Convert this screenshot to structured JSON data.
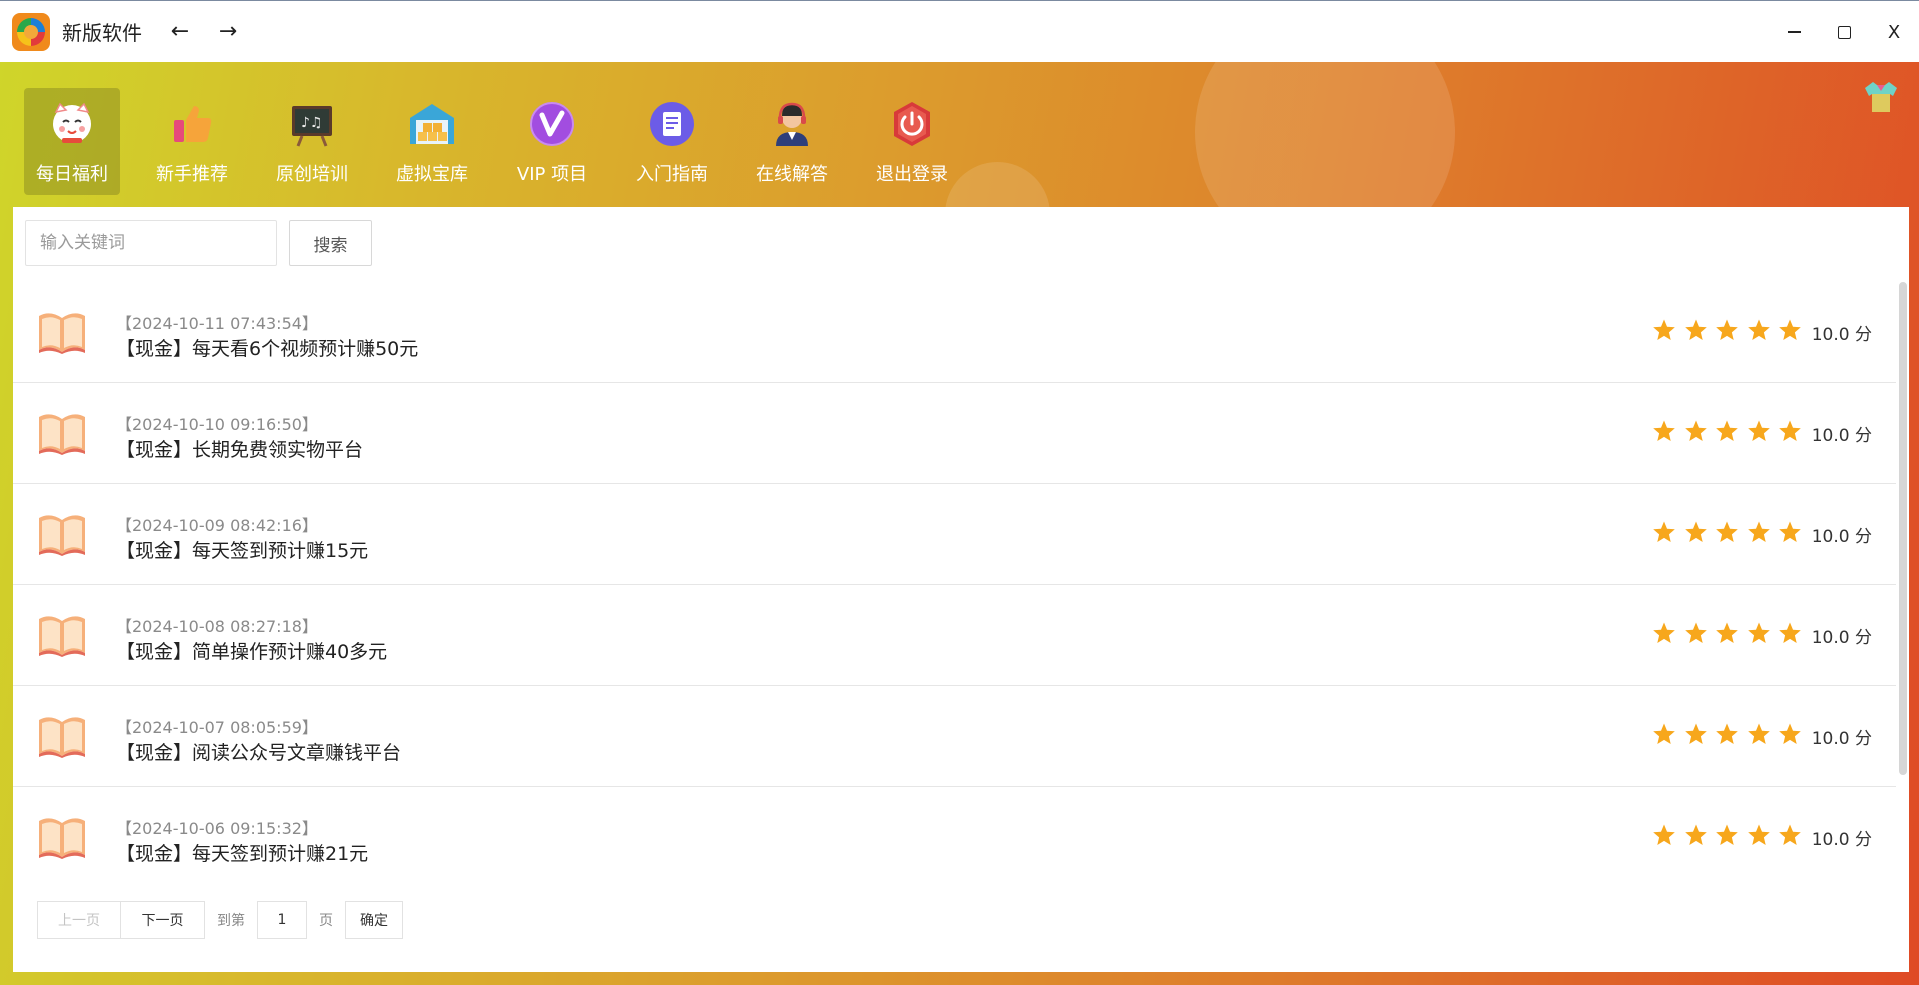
{
  "window": {
    "title": "新版软件",
    "back_icon": "←",
    "forward_icon": "→",
    "close_icon": "X"
  },
  "toolbar": {
    "items": [
      {
        "label": "每日福利",
        "icon": "lucky-cat-icon",
        "active": true
      },
      {
        "label": "新手推荐",
        "icon": "thumbs-up-icon",
        "active": false
      },
      {
        "label": "原创培训",
        "icon": "blackboard-icon",
        "active": false
      },
      {
        "label": "虚拟宝库",
        "icon": "warehouse-icon",
        "active": false
      },
      {
        "label": "VIP 项目",
        "icon": "vip-badge-icon",
        "active": false
      },
      {
        "label": "入门指南",
        "icon": "document-icon",
        "active": false
      },
      {
        "label": "在线解答",
        "icon": "support-agent-icon",
        "active": false
      },
      {
        "label": "退出登录",
        "icon": "power-icon",
        "active": false
      }
    ]
  },
  "search": {
    "placeholder": "输入关键词",
    "value": "",
    "button_label": "搜索"
  },
  "list": {
    "items": [
      {
        "date": "【2024-10-11 07:43:54】",
        "title": "【现金】每天看6个视频预计赚50元",
        "stars": 5,
        "score": "10.0 分"
      },
      {
        "date": "【2024-10-10 09:16:50】",
        "title": "【现金】长期免费领实物平台",
        "stars": 5,
        "score": "10.0 分"
      },
      {
        "date": "【2024-10-09 08:42:16】",
        "title": "【现金】每天签到预计赚15元",
        "stars": 5,
        "score": "10.0 分"
      },
      {
        "date": "【2024-10-08 08:27:18】",
        "title": "【现金】简单操作预计赚40多元",
        "stars": 5,
        "score": "10.0 分"
      },
      {
        "date": "【2024-10-07 08:05:59】",
        "title": "【现金】阅读公众号文章赚钱平台",
        "stars": 5,
        "score": "10.0 分"
      },
      {
        "date": "【2024-10-06 09:15:32】",
        "title": "【现金】每天签到预计赚21元",
        "stars": 5,
        "score": "10.0 分"
      }
    ]
  },
  "pagination": {
    "prev_label": "上一页",
    "next_label": "下一页",
    "goto_label": "到第",
    "page_value": "1",
    "page_unit": "页",
    "confirm_label": "确定"
  },
  "colors": {
    "star": "#f7a71c",
    "gradient_start": "#cfd52a",
    "gradient_end": "#df4a25"
  }
}
